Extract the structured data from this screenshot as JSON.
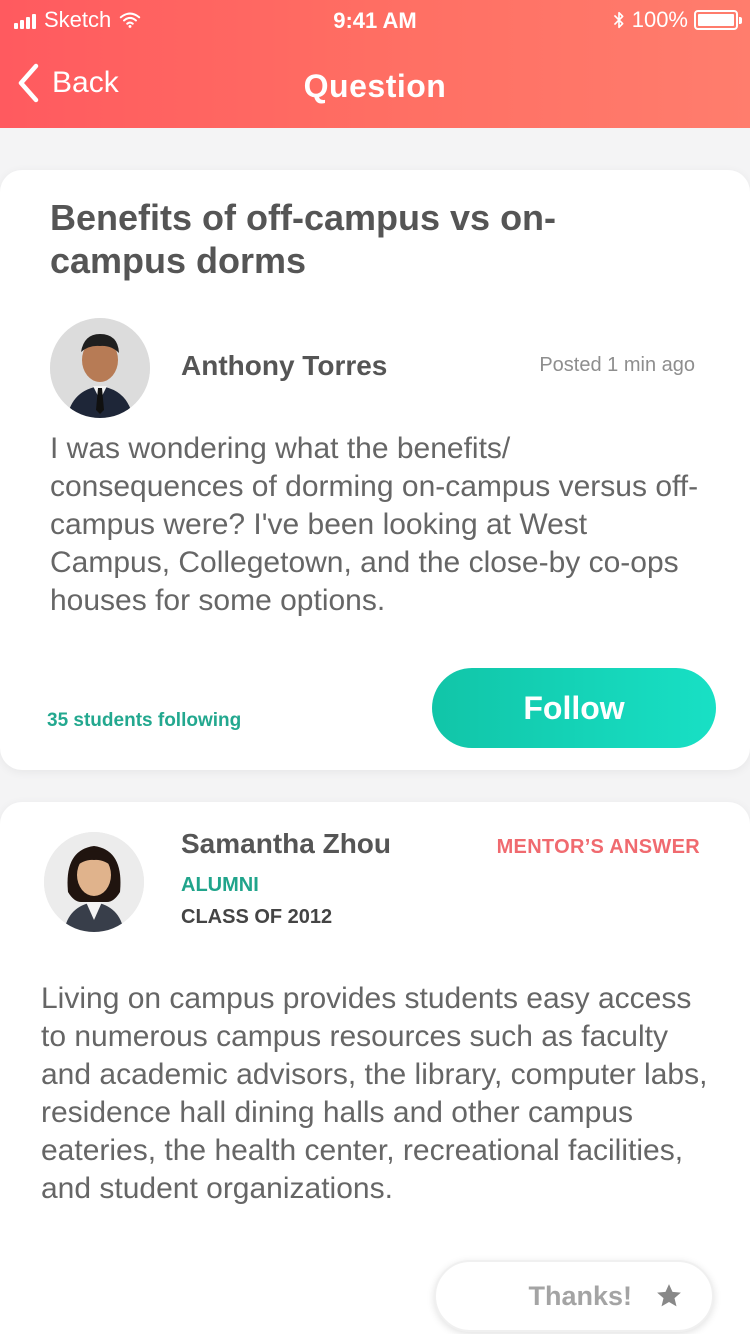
{
  "status_bar": {
    "carrier": "Sketch",
    "time": "9:41 AM",
    "battery_percent": "100%"
  },
  "nav": {
    "back_label": "Back",
    "title": "Question"
  },
  "question": {
    "title": "Benefits of off-campus vs on-campus dorms",
    "author_name": "Anthony Torres",
    "posted": "Posted 1 min ago",
    "body": "I was wondering what the benefits/ consequences of dorming on-campus versus off-campus were? I've been looking at West Campus, Collegetown, and the close-by co-ops houses for some options.",
    "following": "35 students following",
    "follow_label": "Follow"
  },
  "answer": {
    "author_name": "Samantha Zhou",
    "tag": "MENTOR’S ANSWER",
    "role": "ALUMNI",
    "class_year": "CLASS OF 2012",
    "body": "Living on campus provides students easy access to numerous campus resources such as faculty and academic advisors, the library, computer labs, residence hall dining halls and other campus eateries, the health center, recreational facilities, and student organizations.",
    "thanks_label": "Thanks!"
  },
  "colors": {
    "header_gradient_start": "#ff5a5f",
    "header_gradient_end": "#ff7d6d",
    "accent_teal": "#18e0c5",
    "mentor_red": "#f06a6f",
    "role_green": "#20a48b"
  },
  "icons": [
    "signal-icon",
    "wifi-icon",
    "bluetooth-icon",
    "battery-icon",
    "back-chevron-icon",
    "star-icon"
  ]
}
